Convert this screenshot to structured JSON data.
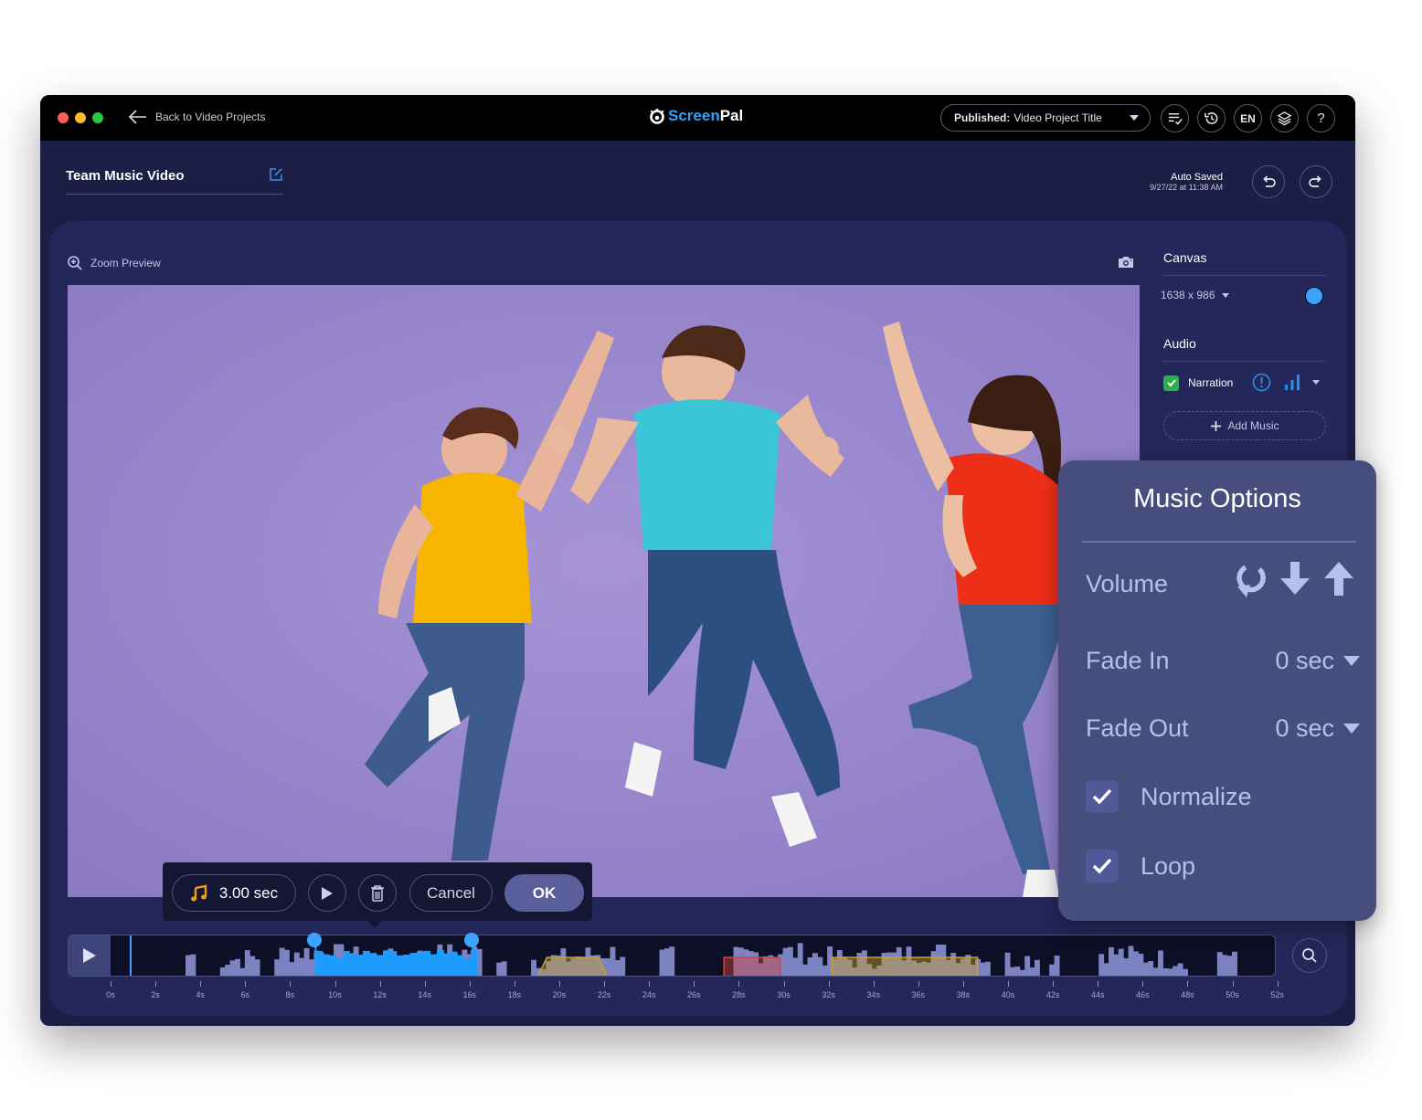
{
  "titlebar": {
    "back_label": "Back to Video Projects",
    "logo_screen": "Screen",
    "logo_pal": "Pal",
    "publish_prefix": "Published:",
    "publish_title": "Video Project Title",
    "language": "EN",
    "help": "?"
  },
  "project": {
    "title": "Team Music Video",
    "autosave_label": "Auto Saved",
    "autosave_time": "9/27/22 at 11:38 AM"
  },
  "preview": {
    "zoom_label": "Zoom Preview"
  },
  "side_panel": {
    "canvas_heading": "Canvas",
    "canvas_size": "1638 x 986",
    "canvas_color": "#3da2ff",
    "audio_heading": "Audio",
    "narration_label": "Narration",
    "narration_checked": true,
    "add_music_label": "Add Music"
  },
  "music_options": {
    "title": "Music Options",
    "volume_label": "Volume",
    "fade_in_label": "Fade In",
    "fade_in_value": "0 sec",
    "fade_out_label": "Fade Out",
    "fade_out_value": "0 sec",
    "normalize_label": "Normalize",
    "normalize_checked": true,
    "loop_label": "Loop",
    "loop_checked": true
  },
  "clip_toolbar": {
    "duration": "3.00 sec",
    "cancel_label": "Cancel",
    "ok_label": "OK"
  },
  "timeline": {
    "ticks": [
      "0s",
      "2s",
      "4s",
      "6s",
      "8s",
      "10s",
      "12s",
      "14s",
      "16s",
      "18s",
      "20s",
      "22s",
      "24s",
      "26s",
      "28s",
      "30s",
      "32s",
      "34s",
      "36s",
      "38s",
      "40s",
      "42s",
      "44s",
      "46s",
      "48s",
      "50s",
      "52s"
    ],
    "selection_start_sec": 9.1,
    "selection_end_sec": 16.1,
    "playhead_sec": 0.9,
    "segments": [
      {
        "type": "fade",
        "color": "#c9a227",
        "start_sec": 19.0,
        "end_sec": 22.1
      },
      {
        "type": "cut",
        "color": "#d3473f",
        "start_sec": 27.3,
        "end_sec": 29.8
      },
      {
        "type": "fade",
        "color": "#c9a227",
        "start_sec": 32.1,
        "end_sec": 38.6
      }
    ],
    "colors": {
      "selection": "#1e9bff",
      "waveform": "#7d82c0"
    }
  }
}
